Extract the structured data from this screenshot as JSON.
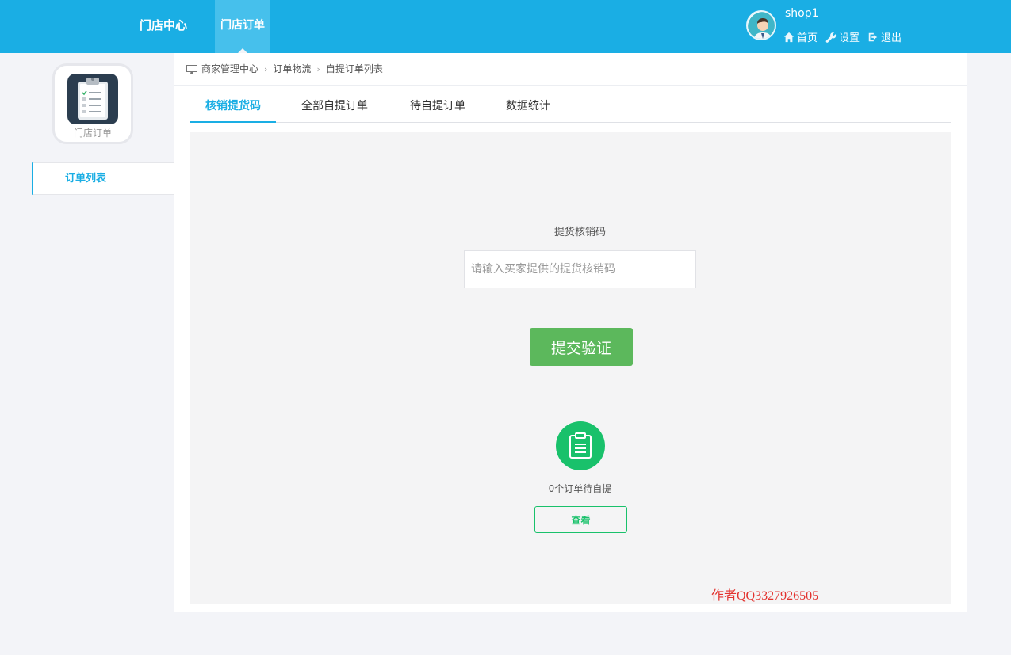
{
  "topnav": {
    "items": [
      {
        "label": "门店中心",
        "active": false
      },
      {
        "label": "门店订单",
        "active": true
      }
    ]
  },
  "user": {
    "name": "shop1",
    "links": [
      {
        "icon": "home-icon",
        "label": "首页"
      },
      {
        "icon": "wrench-icon",
        "label": "设置"
      },
      {
        "icon": "logout-icon",
        "label": "退出"
      }
    ]
  },
  "sidebar": {
    "app_label": "门店订单",
    "items": [
      {
        "label": "订单列表",
        "active": true
      }
    ]
  },
  "breadcrumb": [
    "商家管理中心",
    "订单物流",
    "自提订单列表"
  ],
  "tabs": [
    {
      "label": "核销提货码",
      "active": true
    },
    {
      "label": "全部自提订单",
      "active": false
    },
    {
      "label": "待自提订单",
      "active": false
    },
    {
      "label": "数据统计",
      "active": false
    }
  ],
  "verify": {
    "label": "提货核销码",
    "placeholder": "请输入买家提供的提货核销码",
    "value": "",
    "submit_label": "提交验证"
  },
  "pending": {
    "text": "0个订单待自提",
    "button": "查看",
    "icon": "clipboard-icon"
  },
  "watermark": "作者QQ3327926505",
  "colors": {
    "brand": "#1aaee4",
    "submit": "#5cb85c",
    "pending": "#19c16b",
    "watermark": "#e3322e"
  }
}
